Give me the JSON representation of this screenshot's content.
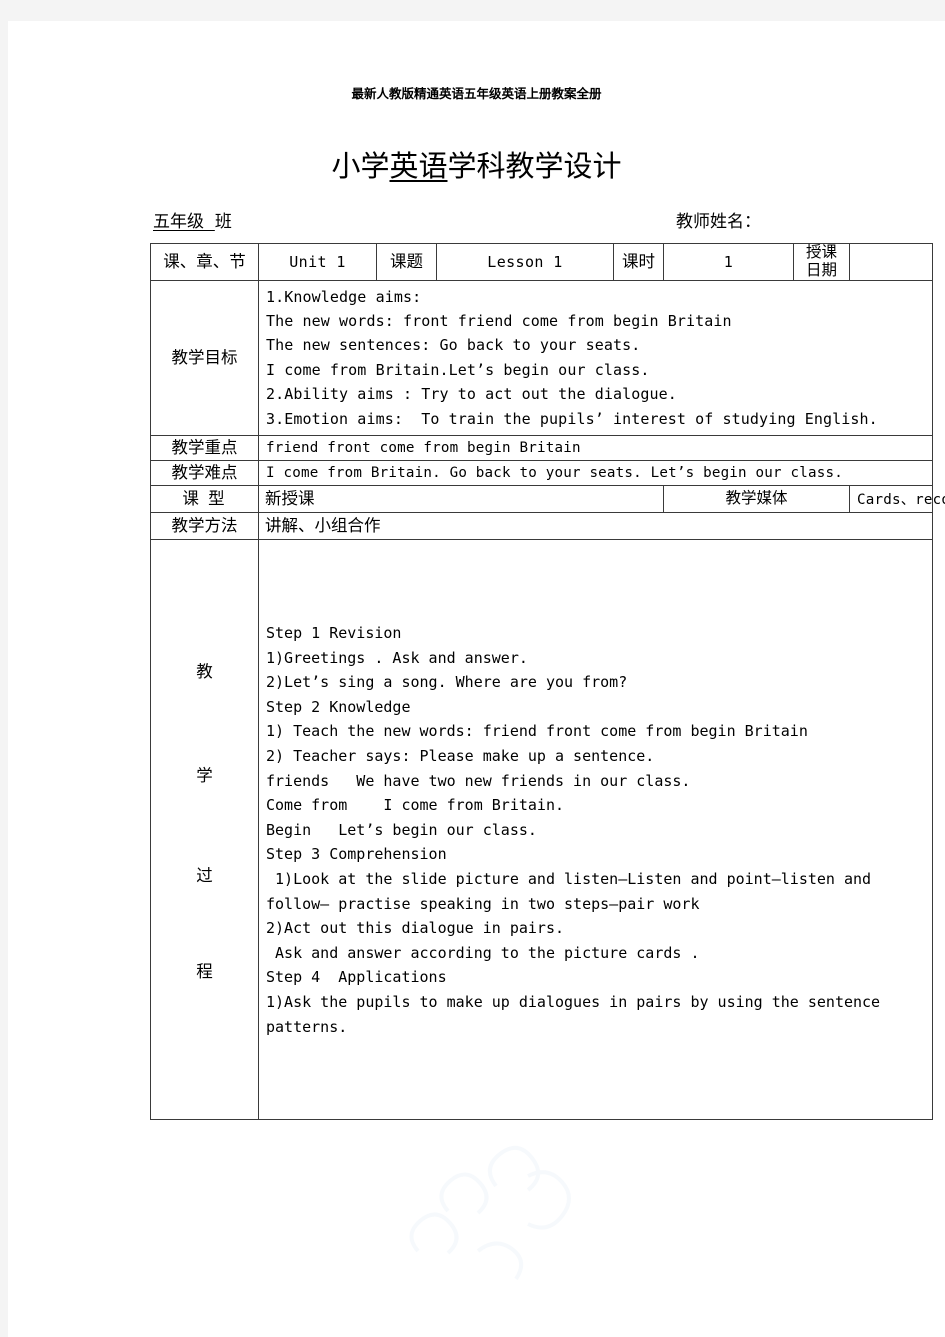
{
  "document": {
    "header_text": "最新人教版精通英语五年级英语上册教案全册",
    "title_prefix": "小学",
    "title_subject": "英语",
    "title_suffix": "学科教学设计",
    "grade_label": "五年级",
    "grade_suffix": "班",
    "teacher_label": "教师姓名："
  },
  "table": {
    "row_lesson": {
      "label_chapter": "课、章、节",
      "value_unit": "Unit 1",
      "label_topic": "课题",
      "value_topic": "Lesson 1",
      "label_periods": "课时",
      "value_periods": "1",
      "label_date": "授课\n日期",
      "value_date": ""
    },
    "row_objectives": {
      "label": "教学目标",
      "content": "1.Knowledge aims:\nThe new words: front friend come from begin Britain\nThe new sentences: Go back to your seats.\nI come from Britain.Let’s begin our class.\n2.Ability aims : Try to act out the dialogue.\n3.Emotion aims:  To train the pupils’ interest of studying English."
    },
    "row_key_points": {
      "label": "教学重点",
      "content": "friend front come from begin Britain"
    },
    "row_difficulties": {
      "label": "教学难点",
      "content": "I come from Britain. Go back to your seats.  Let’s begin our class."
    },
    "row_type": {
      "label": "课   型",
      "value": "新授课",
      "label_media": "教学媒体",
      "value_media": "Cards、recorder"
    },
    "row_methods": {
      "label": "教学方法",
      "content": "讲解、小组合作"
    },
    "row_process": {
      "label_chars": [
        "教",
        "学",
        "过",
        "程"
      ],
      "content": "Step 1 Revision\n1)Greetings . Ask and answer.\n2)Let’s sing a song. Where are you from?\nStep 2 Knowledge\n1) Teach the new words: friend front come from begin Britain\n2) Teacher says: Please make up a sentence.\nfriends   We have two new friends in our class.\nCome from    I come from Britain.\nBegin   Let’s begin our class.\nStep 3 Comprehension\n 1)Look at the slide picture and listen—Listen and point—listen and follow— practise speaking in two steps—pair work\n2)Act out this dialogue in pairs.\n Ask and answer according to the picture cards .\nStep 4  Applications\n1)Ask the pupils to make up dialogues in pairs by using the sentence patterns."
    }
  },
  "colors": {
    "page_background": "#ffffff",
    "canvas_background": "#f4f4f4",
    "border": "#3a3a3a",
    "text": "#000000"
  }
}
